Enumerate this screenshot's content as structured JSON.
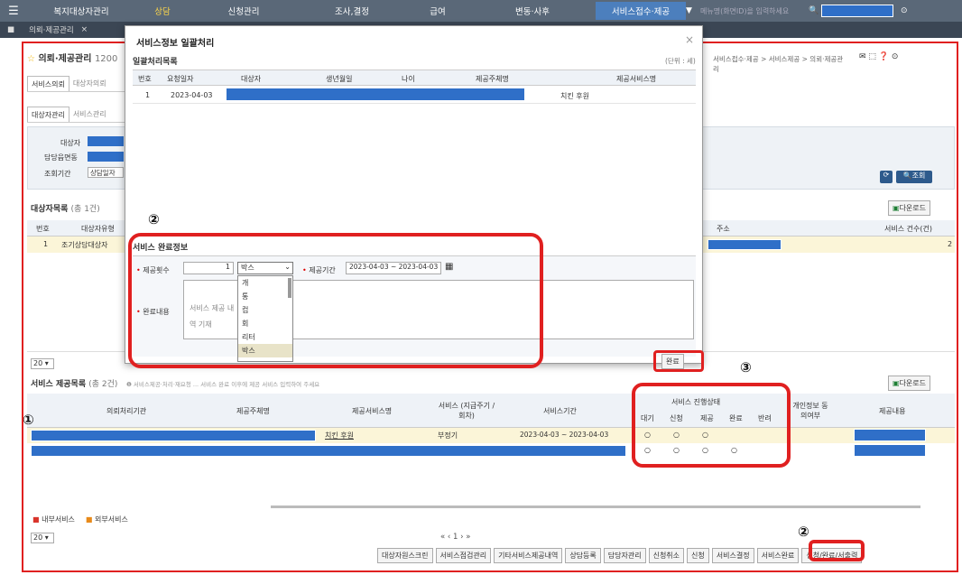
{
  "topnav": {
    "items": [
      "복지대상자관리",
      "상담",
      "신청관리",
      "조사,결정",
      "급여",
      "변동·사후",
      "서비스접수·제공"
    ],
    "placeholder": "메뉴명(화면ID)을 입력하세요"
  },
  "tabs": [
    "의뢰·제공관리"
  ],
  "page": {
    "title": "의뢰·제공관리",
    "title_code": "1200",
    "breadcrumb": "서비스접수·제공 > 서비스제공 > 의뢰·제공관리"
  },
  "subtabs": [
    "서비스의뢰",
    "대상자의뢰"
  ],
  "subtabs2": [
    "대상자관리",
    "서비스관리"
  ],
  "filters": {
    "target": "대상자",
    "dong": "담당읍면동",
    "period": "조회기간",
    "period_value": "상담일자",
    "search": "조회"
  },
  "list1": {
    "title": "대상자목록",
    "count": "(총 1건)",
    "download": "다운로드",
    "cols": [
      "번호",
      "대상자유형",
      "주소",
      "서비스 건수(건)"
    ],
    "row": {
      "no": "1",
      "type": "조기상담대상자",
      "count": "2"
    }
  },
  "pager": {
    "size": "20"
  },
  "list2": {
    "title": "서비스 제공목록",
    "count": "(총 2건)",
    "note": "❶ 서비스제공·처리·재요청 ... 서비스 완료 이후에 제공 서비스 입력하여 주세요",
    "download": "다운로드",
    "cols": [
      "의뢰처리기관",
      "제공주체명",
      "제공서비스명",
      "서비스 (지급주기 / 회차)",
      "서비스기간",
      "서비스 진행상태",
      "개인정보 동의여부",
      "제공내용"
    ],
    "status_cols": [
      "대기",
      "신청",
      "제공",
      "완료",
      "반려"
    ],
    "rows": [
      {
        "service": "치킨 후원",
        "cycle": "부정기",
        "period": "2023-04-03 ~ 2023-04-03",
        "status": [
          "○",
          "○",
          "○",
          "",
          ""
        ]
      },
      {
        "service": "",
        "cycle": "",
        "period": "",
        "status": [
          "○",
          "○",
          "○",
          "○",
          ""
        ]
      }
    ]
  },
  "legend": {
    "internal": "내부서비스",
    "external": "외부서비스"
  },
  "pager2": {
    "size": "20",
    "pages": "« ‹ 1 › »"
  },
  "footer_buttons": [
    "대상자원스크린",
    "서비스점검관리",
    "기타서비스제공내역",
    "상담등록",
    "담당자관리",
    "신청취소",
    "신청",
    "서비스결정",
    "서비스완료",
    "신청/완료/서출력"
  ],
  "modal": {
    "title": "서비스정보 일괄처리",
    "close": "×",
    "list_title": "일괄처리목록",
    "unit": "(단위 : 세)",
    "cols": [
      "번호",
      "요청일자",
      "대상자",
      "생년월일",
      "나이",
      "제공주체명",
      "제공서비스명"
    ],
    "row": {
      "no": "1",
      "date": "2023-04-03",
      "service": "치킨 후원"
    },
    "section": "서비스 완료정보",
    "count_label": "제공횟수",
    "count_value": "1",
    "unit_select": "박스",
    "unit_options": [
      "개",
      "통",
      "컵",
      "회",
      "리터",
      "박스"
    ],
    "period_label": "제공기간",
    "period_value": "2023-04-03 ~ 2023-04-03",
    "content_label": "완료내용",
    "content_placeholder": "서비스 제공 내역 기재",
    "complete_button": "완료"
  },
  "annotations": {
    "one": "①",
    "two": "②",
    "three": "③"
  }
}
